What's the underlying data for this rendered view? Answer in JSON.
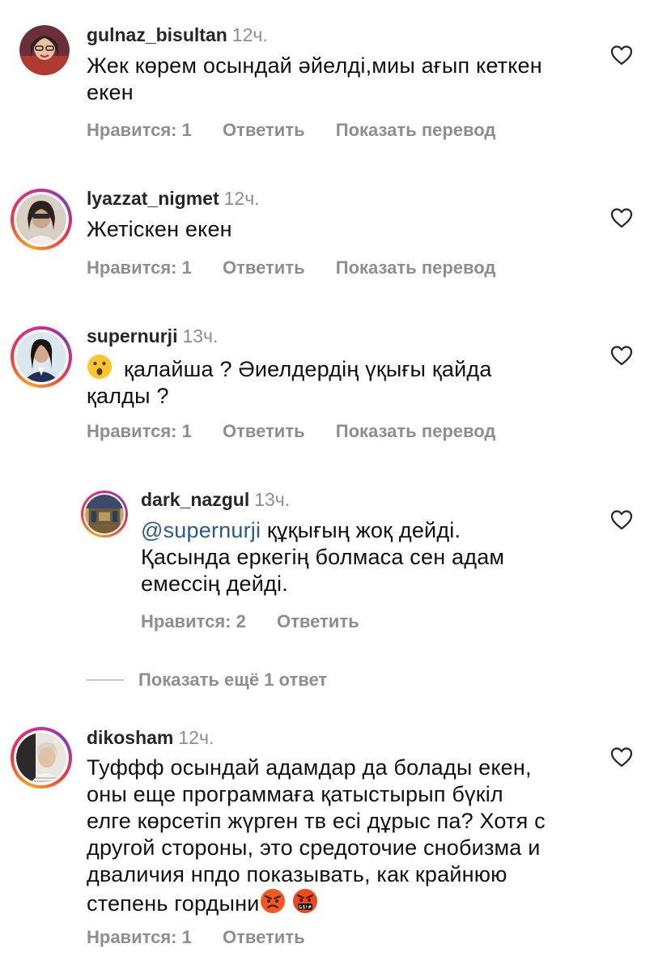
{
  "comments": [
    {
      "username": "gulnaz_bisultan",
      "time": "12ч.",
      "lines": [
        "Жек көрем осындай әйелді,миы ағып кеткен",
        "екен"
      ],
      "likes_label": "Нравится: 1",
      "reply_label": "Ответить",
      "translate_label": "Показать перевод",
      "has_story_ring": false
    },
    {
      "username": "lyazzat_nigmet",
      "time": "12ч.",
      "lines": [
        "Жетіскен екен"
      ],
      "likes_label": "Нравится: 1",
      "reply_label": "Ответить",
      "translate_label": "Показать перевод",
      "has_story_ring": true
    },
    {
      "username": "supernurji",
      "time": "13ч.",
      "emoji": "hushed-face-emoji",
      "lines": [
        "қалайша ? Әиелдердің үқығы қайда",
        "қалды ?"
      ],
      "likes_label": "Нравится: 1",
      "reply_label": "Ответить",
      "translate_label": "Показать перевод",
      "has_story_ring": true
    },
    {
      "username": "dark_nazgul",
      "time": "13ч.",
      "mention": "@supernurji",
      "lines": [
        "құқығың жоқ дейді.",
        "Қасында еркегің болмаса сен адам",
        "емессің дейді."
      ],
      "likes_label": "Нравится: 2",
      "reply_label": "Ответить",
      "has_story_ring": true,
      "is_reply": true
    },
    {
      "username": "dikosham",
      "time": "12ч.",
      "lines": [
        "Туффф осындай адамдар да болады екен,",
        "оны еще программаға қатыстырып бүкіл",
        "елге көрсетіп жүрген тв есі дұрыс па? Хотя с",
        "другой стороны, это средоточие снобизма и",
        "дваличия нпдо показывать, как крайнюю",
        "степень гордыни"
      ],
      "emojis": [
        "angry-face-emoji",
        "cursing-face-emoji"
      ],
      "likes_label": "Нравится: 1",
      "reply_label": "Ответить",
      "has_story_ring": true
    }
  ],
  "show_more_replies": "Показать ещё 1 ответ",
  "icons": {
    "like": "heart-outline-icon"
  },
  "colors": {
    "meta_gray": "#8e8e8e",
    "mention_blue": "#2a5a94",
    "text": "#111111"
  }
}
